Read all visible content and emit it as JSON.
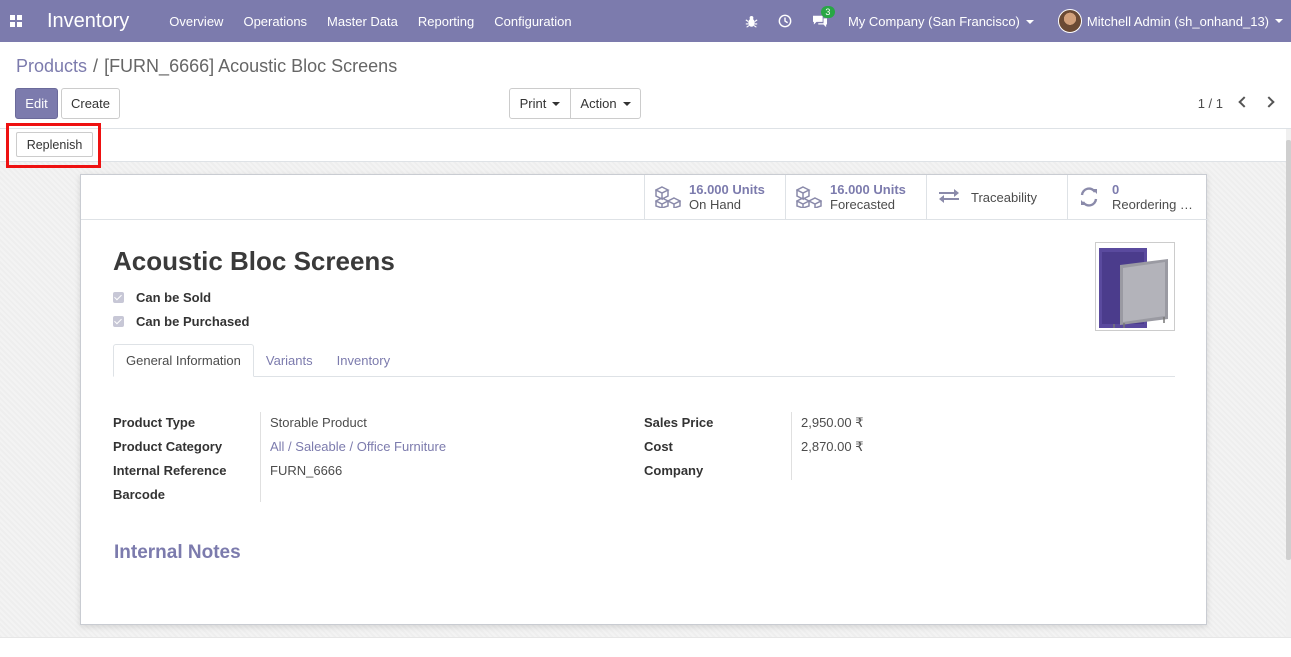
{
  "navbar": {
    "app_title": "Inventory",
    "menu": [
      "Overview",
      "Operations",
      "Master Data",
      "Reporting",
      "Configuration"
    ],
    "chat_badge": "3",
    "company": "My Company (San Francisco)",
    "user": "Mitchell Admin (sh_onhand_13)"
  },
  "breadcrumb": {
    "parent": "Products",
    "separator": "/",
    "current": "[FURN_6666] Acoustic Bloc Screens"
  },
  "toolbar": {
    "edit": "Edit",
    "create": "Create",
    "print": "Print",
    "action": "Action",
    "pager": "1 / 1"
  },
  "statusbar": {
    "replenish": "Replenish"
  },
  "smart_buttons": {
    "on_hand_value": "16.000 Units",
    "on_hand_label": "On Hand",
    "forecasted_value": "16.000 Units",
    "forecasted_label": "Forecasted",
    "traceability_label": "Traceability",
    "reordering_value": "0",
    "reordering_label": "Reordering …"
  },
  "product": {
    "name": "Acoustic Bloc Screens",
    "can_be_sold": "Can be Sold",
    "can_be_purchased": "Can be Purchased"
  },
  "tabs": [
    "General Information",
    "Variants",
    "Inventory"
  ],
  "fields": {
    "product_type_label": "Product Type",
    "product_type_value": "Storable Product",
    "product_category_label": "Product Category",
    "product_category_value": "All / Saleable / Office Furniture",
    "internal_reference_label": "Internal Reference",
    "internal_reference_value": "FURN_6666",
    "barcode_label": "Barcode",
    "sales_price_label": "Sales Price",
    "sales_price_value": "2,950.00 ₹",
    "cost_label": "Cost",
    "cost_value": "2,870.00 ₹",
    "company_label": "Company"
  },
  "notes_heading": "Internal Notes",
  "colors": {
    "brand": "#7c7bad",
    "highlight": "#e11111"
  }
}
